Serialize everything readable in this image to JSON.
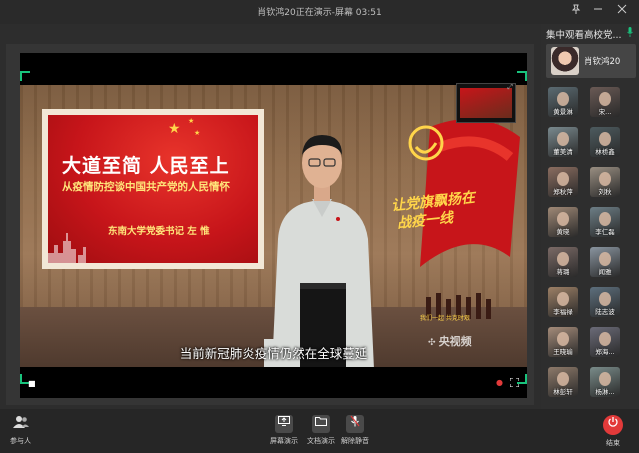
{
  "window": {
    "title": "肖钦鸿20正在演示-屏幕 03:51"
  },
  "video": {
    "board_title": "大道至简   人民至上",
    "board_subtitle": "从疫情防控谈中国共产党的人民情怀",
    "board_author": "东南大学党委书记  左  惟",
    "slogan": "让党旗飘扬在",
    "slogan_line2": "战疫一线",
    "slogan_small": "我们一起  共克时艰",
    "broadcaster": "央视频",
    "subtitle": "当前新冠肺炎疫情仍然在全球蔓延"
  },
  "panel": {
    "title": "集中观看高校党...",
    "host_name": "肖钦鸿20",
    "attendees": [
      {
        "name": "黄景淋",
        "color": "#5b6b72"
      },
      {
        "name": "宋...",
        "color": "#6a5a55"
      },
      {
        "name": "董美清",
        "color": "#7a8a8f"
      },
      {
        "name": "林桥鑫",
        "color": "#4d5b5f"
      },
      {
        "name": "郑秋萍",
        "color": "#8b6d60"
      },
      {
        "name": "刘秋",
        "color": "#9a8f82"
      },
      {
        "name": "黄晓",
        "color": "#a08976"
      },
      {
        "name": "李仁磊",
        "color": "#6d7e86"
      },
      {
        "name": "蒋璐",
        "color": "#7b6a66"
      },
      {
        "name": "闻雅",
        "color": "#8a95a0"
      },
      {
        "name": "李福禄",
        "color": "#9d8066"
      },
      {
        "name": "陆志波",
        "color": "#5d6f7d"
      },
      {
        "name": "王晓瑜",
        "color": "#a58c7a"
      },
      {
        "name": "郑海...",
        "color": "#6b6b78"
      },
      {
        "name": "林彭轩",
        "color": "#8e7a6a"
      },
      {
        "name": "杨淋...",
        "color": "#7a8c8a"
      }
    ]
  },
  "toolbar": {
    "participants_label": "参与人",
    "screen_share_label": "屏幕演示",
    "doc_share_label": "文档演示",
    "unmute_label": "解除静音",
    "end_label": "结束"
  },
  "colors": {
    "accent": "#19c37d",
    "end": "#e23a3a"
  }
}
